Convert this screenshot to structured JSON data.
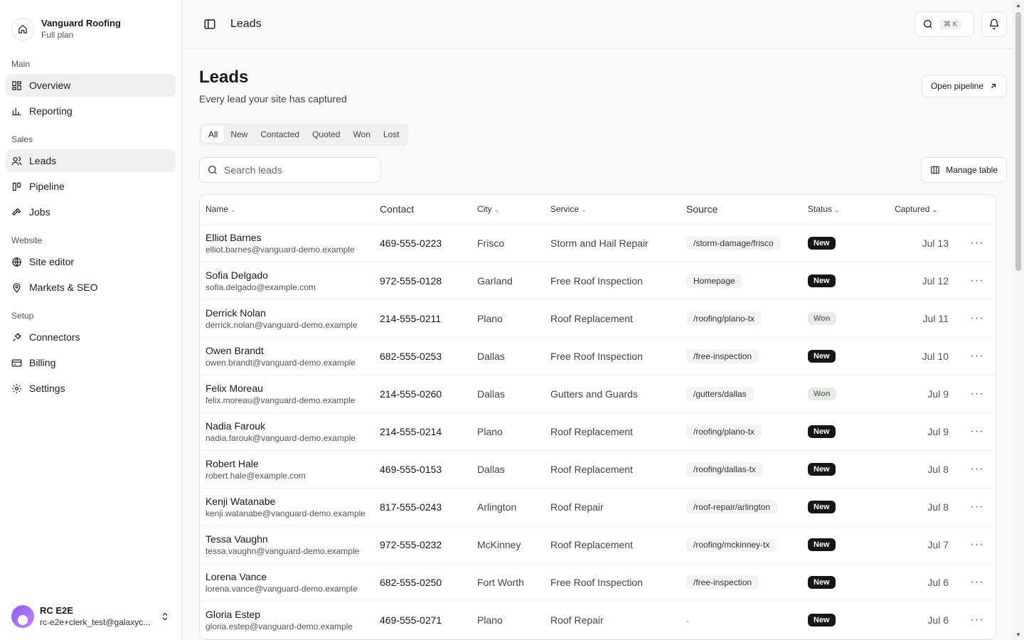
{
  "brand": {
    "name": "Vanguard Roofing",
    "plan": "Full plan"
  },
  "nav": {
    "sections": [
      {
        "heading": "Main",
        "items": [
          {
            "label": "Overview",
            "icon": "dashboard-icon",
            "active": true
          },
          {
            "label": "Reporting",
            "icon": "bar-chart-icon"
          }
        ]
      },
      {
        "heading": "Sales",
        "items": [
          {
            "label": "Leads",
            "icon": "users-icon",
            "active": true
          },
          {
            "label": "Pipeline",
            "icon": "kanban-icon"
          },
          {
            "label": "Jobs",
            "icon": "hammer-icon"
          }
        ]
      },
      {
        "heading": "Website",
        "items": [
          {
            "label": "Site editor",
            "icon": "globe-icon"
          },
          {
            "label": "Markets & SEO",
            "icon": "map-pin-icon"
          }
        ]
      },
      {
        "heading": "Setup",
        "items": [
          {
            "label": "Connectors",
            "icon": "plug-icon"
          },
          {
            "label": "Billing",
            "icon": "credit-card-icon"
          },
          {
            "label": "Settings",
            "icon": "gear-icon"
          }
        ]
      }
    ]
  },
  "user": {
    "name": "RC E2E",
    "email": "rc-e2e+clerk_test@galaxyc..."
  },
  "topbar": {
    "title": "Leads",
    "shortcut": "⌘ K"
  },
  "page": {
    "title": "Leads",
    "subtitle": "Every lead your site has captured",
    "open_pipeline": "Open pipeline",
    "manage_table": "Manage table"
  },
  "tabs": [
    "All",
    "New",
    "Contacted",
    "Quoted",
    "Won",
    "Lost"
  ],
  "search": {
    "placeholder": "Search leads"
  },
  "table": {
    "columns": [
      "Name",
      "Contact",
      "City",
      "Service",
      "Source",
      "Status",
      "Captured"
    ],
    "rows": [
      {
        "name": "Elliot Barnes",
        "email": "elliot.barnes@vanguard-demo.example",
        "contact": "469-555-0223",
        "city": "Frisco",
        "service": "Storm and Hail Repair",
        "source": "/storm-damage/frisco",
        "status": "New",
        "captured": "Jul 13"
      },
      {
        "name": "Sofia Delgado",
        "email": "sofia.delgado@example.com",
        "contact": "972-555-0128",
        "city": "Garland",
        "service": "Free Roof Inspection",
        "source": "Homepage",
        "status": "New",
        "captured": "Jul 12"
      },
      {
        "name": "Derrick Nolan",
        "email": "derrick.nolan@vanguard-demo.example",
        "contact": "214-555-0211",
        "city": "Plano",
        "service": "Roof Replacement",
        "source": "/roofing/plano-tx",
        "status": "Won",
        "captured": "Jul 11"
      },
      {
        "name": "Owen Brandt",
        "email": "owen.brandt@vanguard-demo.example",
        "contact": "682-555-0253",
        "city": "Dallas",
        "service": "Free Roof Inspection",
        "source": "/free-inspection",
        "status": "New",
        "captured": "Jul 10"
      },
      {
        "name": "Felix Moreau",
        "email": "felix.moreau@vanguard-demo.example",
        "contact": "214-555-0260",
        "city": "Dallas",
        "service": "Gutters and Guards",
        "source": "/gutters/dallas",
        "status": "Won",
        "captured": "Jul 9"
      },
      {
        "name": "Nadia Farouk",
        "email": "nadia.farouk@vanguard-demo.example",
        "contact": "214-555-0214",
        "city": "Plano",
        "service": "Roof Replacement",
        "source": "/roofing/plano-tx",
        "status": "New",
        "captured": "Jul 9"
      },
      {
        "name": "Robert Hale",
        "email": "robert.hale@example.com",
        "contact": "469-555-0153",
        "city": "Dallas",
        "service": "Roof Replacement",
        "source": "/roofing/dallas-tx",
        "status": "New",
        "captured": "Jul 8"
      },
      {
        "name": "Kenji Watanabe",
        "email": "kenji.watanabe@vanguard-demo.example",
        "contact": "817-555-0243",
        "city": "Arlington",
        "service": "Roof Repair",
        "source": "/roof-repair/arlington",
        "status": "New",
        "captured": "Jul 8"
      },
      {
        "name": "Tessa Vaughn",
        "email": "tessa.vaughn@vanguard-demo.example",
        "contact": "972-555-0232",
        "city": "McKinney",
        "service": "Roof Replacement",
        "source": "/roofing/mckinney-tx",
        "status": "New",
        "captured": "Jul 7"
      },
      {
        "name": "Lorena Vance",
        "email": "lorena.vance@vanguard-demo.example",
        "contact": "682-555-0250",
        "city": "Fort Worth",
        "service": "Free Roof Inspection",
        "source": "/free-inspection",
        "status": "New",
        "captured": "Jul 6"
      },
      {
        "name": "Gloria Estep",
        "email": "gloria.estep@vanguard-demo.example",
        "contact": "469-555-0271",
        "city": "Plano",
        "service": "Roof Repair",
        "source": "-",
        "status": "New",
        "captured": "Jul 6"
      }
    ]
  },
  "colors": {
    "status_new_bg": "#161616",
    "status_won_bg": "#e6ece8",
    "active_nav_bg": "#f0f0f0"
  }
}
